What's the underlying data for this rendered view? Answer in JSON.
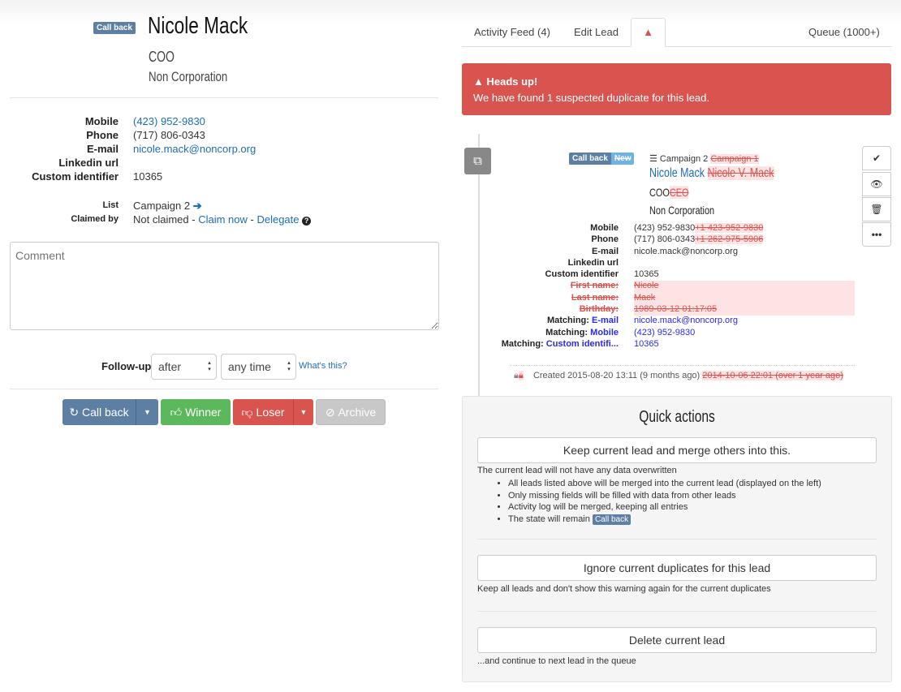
{
  "lead": {
    "status": "Call back",
    "name": "Nicole Mack",
    "title": "COO",
    "company": "Non Corporation"
  },
  "fields": [
    {
      "label": "Mobile",
      "value": "(423) 952-9830",
      "link": true
    },
    {
      "label": "Phone",
      "value": "(717) 806-0343",
      "link": false
    },
    {
      "label": "E-mail",
      "value": "nicole.mack@noncorp.org",
      "link": true
    },
    {
      "label": "Linkedin url",
      "value": "",
      "link": false
    },
    {
      "label": "Custom identifier",
      "value": "10365",
      "link": false
    }
  ],
  "list": {
    "label": "List",
    "value": "Campaign 2",
    "claimed_label": "Claimed by",
    "claimed_value": "Not claimed - ",
    "claim_now": "Claim now",
    "sep": " - ",
    "delegate": "Delegate"
  },
  "comment": {
    "placeholder": "Comment"
  },
  "followup": {
    "label": "Follow-up",
    "when": "after",
    "time": "any time",
    "help": "What's this?"
  },
  "actions": {
    "callback": "Call back",
    "winner": "Winner",
    "loser": "Loser",
    "archive": "Archive"
  },
  "tabs": {
    "activity": "Activity Feed (4)",
    "edit": "Edit Lead",
    "queue": "Queue (1000+)"
  },
  "alert": {
    "title": "Heads up!",
    "text": "We have found 1 suspected duplicate for this lead."
  },
  "duplicate": {
    "status": "Call back",
    "old_status": "New",
    "campaign": "Campaign 2",
    "old_campaign": "Campaign 1",
    "name": "Nicole Mack",
    "old_name": "Nicole V. Mack",
    "title": "COO",
    "old_title": "CEO",
    "company": "Non Corporation",
    "fields": [
      {
        "label": "Mobile",
        "value": "(423) 952-9830",
        "old": "+1 423-952-9830"
      },
      {
        "label": "Phone",
        "value": "(717) 806-0343",
        "old": "+1 262-975-5906"
      },
      {
        "label": "E-mail",
        "value": "nicole.mack@noncorp.org",
        "old": ""
      },
      {
        "label": "Linkedin url",
        "value": "",
        "old": ""
      },
      {
        "label": "Custom identifier",
        "value": "10365",
        "old": ""
      }
    ],
    "removed": [
      {
        "label": "First name:",
        "value": "Nicole"
      },
      {
        "label": "Last name:",
        "value": "Mack"
      },
      {
        "label": "Birthday:",
        "value": "1989-03-12 01:17:05"
      }
    ],
    "matching": [
      {
        "prefix": "Matching: ",
        "field": "E-mail",
        "value": "nicole.mack@noncorp.org"
      },
      {
        "prefix": "Matching: ",
        "field": "Mobile",
        "value": "(423) 952-9830"
      },
      {
        "prefix": "Matching: ",
        "field": "Custom identifi...",
        "value": "10365"
      }
    ],
    "created": "Created 2015-08-20 13:11 (9 months ago)",
    "old_created": "2014-10-06 22:01 (over 1 year ago)"
  },
  "quick": {
    "title": "Quick actions",
    "merge": "Keep current lead and merge others into this.",
    "merge_note": "The current lead will not have any data overwritten",
    "bullets": [
      "All leads listed above will be merged into the current lead (displayed on the left)",
      "Only missing fields will be filled with data from other leads",
      "Activity log will be merged, keeping all entries",
      "The state will remain "
    ],
    "state": "Call back",
    "ignore": "Ignore current duplicates for this lead",
    "ignore_note": "Keep all leads and don't show this warning again for the current duplicates",
    "delete": "Delete current lead",
    "delete_note": "...and continue to next lead in the queue"
  }
}
